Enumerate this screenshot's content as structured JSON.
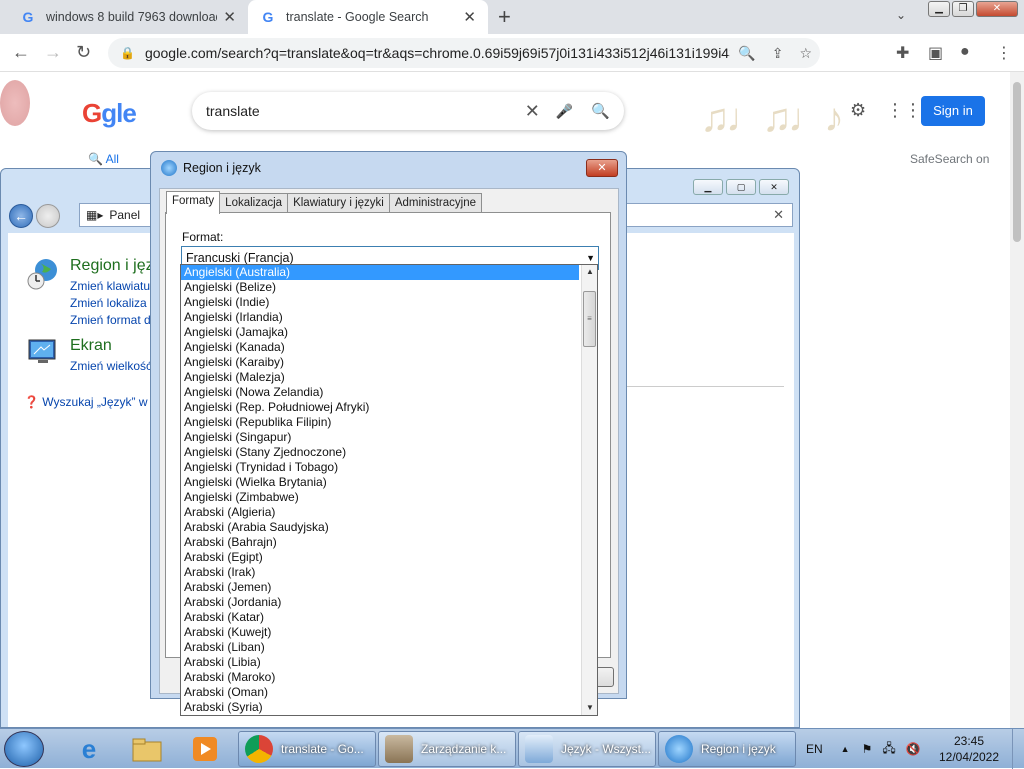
{
  "browser": {
    "tabs": [
      {
        "label": "windows 8 build 7963 download",
        "close": "✕",
        "icon": "G"
      },
      {
        "label": "translate - Google Search",
        "close": "✕",
        "icon": "G"
      }
    ],
    "new_tab": "+",
    "url": "google.com/search?q=translate&oq=tr&aqs=chrome.0.69i59j69i57j0i131i433i512j46i131i199i433i465i..."
  },
  "google": {
    "logo_g": "G",
    "logo_rest": "gle",
    "query": "translate",
    "tab_all": "All",
    "safesearch": "SafeSearch on",
    "signin": "Sign in",
    "notes": "♫♩♫♩♪"
  },
  "control_panel": {
    "address": "Panel",
    "region_title": "Region i jęz",
    "region_links": [
      "Zmień klawiatu",
      "Zmień lokaliza",
      "Zmień format d"
    ],
    "display_title": "Ekran",
    "display_link": "Zmień wielkość",
    "help": "Wyszukaj „Język” w P"
  },
  "dialog": {
    "title": "Region i język",
    "tabs": [
      "Formaty",
      "Lokalizacja",
      "Klawiatury i języki",
      "Administracyjne"
    ],
    "format_label": "Format:",
    "selected": "Francuski (Francja)",
    "options": [
      "Angielski (Australia)",
      "Angielski (Belize)",
      "Angielski (Indie)",
      "Angielski (Irlandia)",
      "Angielski (Jamajka)",
      "Angielski (Kanada)",
      "Angielski (Karaiby)",
      "Angielski (Malezja)",
      "Angielski (Nowa Zelandia)",
      "Angielski (Rep. Południowej Afryki)",
      "Angielski (Republika Filipin)",
      "Angielski (Singapur)",
      "Angielski (Stany Zjednoczone)",
      "Angielski (Trynidad i Tobago)",
      "Angielski (Wielka Brytania)",
      "Angielski (Zimbabwe)",
      "Arabski (Algieria)",
      "Arabski (Arabia Saudyjska)",
      "Arabski (Bahrajn)",
      "Arabski (Egipt)",
      "Arabski (Irak)",
      "Arabski (Jemen)",
      "Arabski (Jordania)",
      "Arabski (Katar)",
      "Arabski (Kuwejt)",
      "Arabski (Liban)",
      "Arabski (Libia)",
      "Arabski (Maroko)",
      "Arabski (Oman)",
      "Arabski (Syria)"
    ],
    "highlighted_index": 0
  },
  "taskbar": {
    "tasks": [
      "translate - Go...",
      "Zarządzanie k...",
      "Język - Wszyst...",
      "Region i język"
    ],
    "lang": "EN",
    "time": "23:45",
    "date": "12/04/2022"
  }
}
